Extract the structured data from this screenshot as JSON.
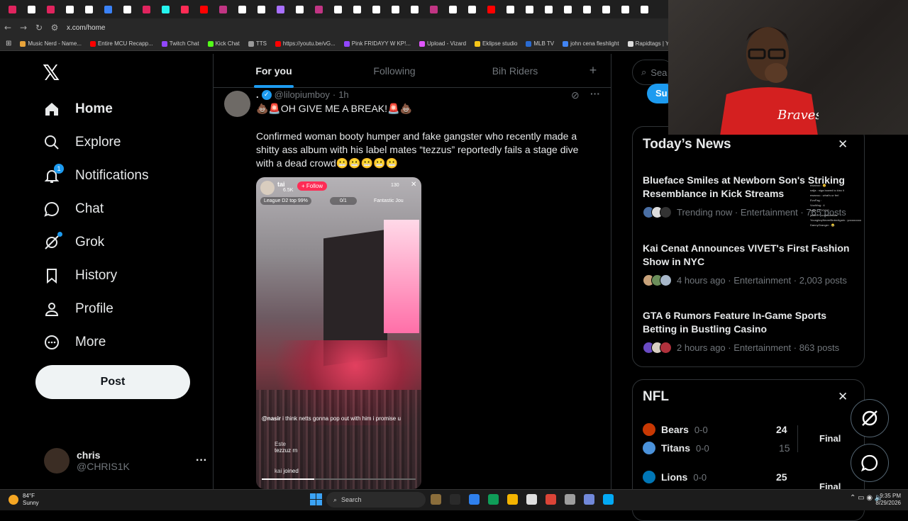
{
  "browser": {
    "url": "x.com/home",
    "tab_count": 34,
    "bookmarks": [
      {
        "label": "Music Nerd - Name...",
        "color": "#e8a33a"
      },
      {
        "label": "Entire MCU Recapp...",
        "color": "#ff0000"
      },
      {
        "label": "Twitch Chat",
        "color": "#9146ff"
      },
      {
        "label": "Kick Chat",
        "color": "#53fc18"
      },
      {
        "label": "TTS",
        "color": "#999999"
      },
      {
        "label": "https://youtu.be/vG...",
        "color": "#ff0000"
      },
      {
        "label": "Pink FRIDAYY W KP!...",
        "color": "#9146ff"
      },
      {
        "label": "Upload - Vizard",
        "color": "#e056fd"
      },
      {
        "label": "Eklipse studio",
        "color": "#f5c518"
      },
      {
        "label": "MLB TV",
        "color": "#2a6bd1"
      },
      {
        "label": "john cena fleshlight",
        "color": "#4285f4"
      },
      {
        "label": "Rapidtags | YouTub...",
        "color": "#dddddd"
      }
    ]
  },
  "nav": {
    "items": [
      {
        "label": "Home",
        "icon": "home-icon",
        "active": true
      },
      {
        "label": "Explore",
        "icon": "search-icon"
      },
      {
        "label": "Notifications",
        "icon": "bell-icon",
        "badge": "1"
      },
      {
        "label": "Chat",
        "icon": "chat-icon"
      },
      {
        "label": "Grok",
        "icon": "grok-icon"
      },
      {
        "label": "History",
        "icon": "bookmark-icon"
      },
      {
        "label": "Profile",
        "icon": "person-icon"
      },
      {
        "label": "More",
        "icon": "more-circle-icon"
      }
    ],
    "post_label": "Post",
    "account": {
      "name": "chris",
      "handle": "@CHRIS1K"
    }
  },
  "feed": {
    "tabs": [
      "For you",
      "Following",
      "Bih Riders"
    ],
    "add_tab_icon": "+",
    "tweet": {
      "name": ".",
      "handle": "@lilopiumboy",
      "time": "1h",
      "headline": "💩🚨OH GIVE ME A BREAK!🚨💩",
      "body": "Confirmed woman booty humper and fake gangster who recently made a shitty ass album with his label mates “tezzus” reportedly fails a stage dive with a dead crowd😬😬😬😬😬",
      "media": {
        "streamer": "tai",
        "followers": "6.5K",
        "follow_label": "+ Follow",
        "viewers": "130",
        "league": "League D2 top 99%",
        "progress": "0/1",
        "badge": "Fantastic Jou",
        "comments": [
          {
            "user": "@nasir",
            "text": "i think netts gonna pop out with him i promise u"
          },
          {
            "user": "Este",
            "text": "tezzuz rn"
          },
          {
            "user": "kai",
            "text": "joined"
          }
        ]
      }
    }
  },
  "right": {
    "search_placeholder": "Sea",
    "subscribe_label": "Su",
    "news_title": "Today’s News",
    "news": [
      {
        "headline": "Blueface Smiles at Newborn Son's Striking Resemblance in Kick Streams",
        "meta": "Trending now · Entertainment · 765 posts"
      },
      {
        "headline": "Kai Cenat Announces VIVET's First Fashion Show in NYC",
        "meta": "4 hours ago · Entertainment · 2,003 posts"
      },
      {
        "headline": "GTA 6 Rumors Feature In-Game Sports Betting in Bustling Casino",
        "meta": "2 hours ago · Entertainment · 863 posts"
      }
    ],
    "nfl_title": "NFL",
    "games": [
      {
        "team1": "Bears",
        "rec1": "0-0",
        "score1": "24",
        "team2": "Titans",
        "rec2": "0-0",
        "score2": "15",
        "status": "Final"
      },
      {
        "team1": "Lions",
        "rec1": "0-0",
        "score1": "25",
        "status": "Final"
      }
    ]
  },
  "taskbar": {
    "temp": "84°F",
    "condition": "Sunny",
    "search_label": "Search",
    "time": "9:35 PM",
    "date": "8/29/2026"
  },
  "overlay_chat": [
    "ewwvoo : 😊",
    "naija : niga bowed to kiss it",
    "ewwvoo : what's ur ferl",
    "EvoFag :",
    "VooWog : 4",
    "naija : YOOOO",
    "jaiden : yoooooooooo",
    "YoungboyNeverBrokeAgain : yoooooooo",
    "DannyGranger : 😂"
  ],
  "colors": {
    "accent": "#1d9bf0",
    "bg": "#000000",
    "text": "#e7e9ea",
    "muted": "#71767b",
    "border": "#2f3336"
  }
}
